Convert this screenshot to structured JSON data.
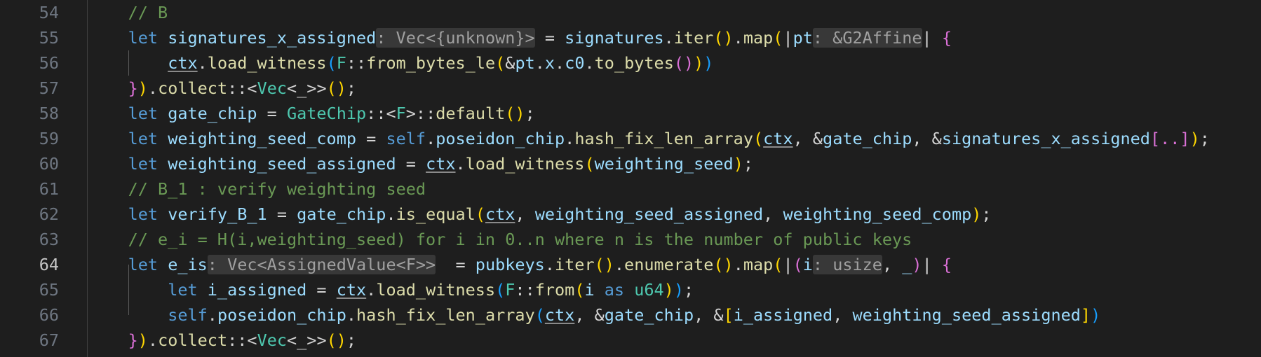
{
  "editor": {
    "active_line": "64",
    "colors": {
      "background": "#1e1e1e",
      "keyword": "#569cd6",
      "variable": "#9cdcfe",
      "function": "#dcdcaa",
      "type": "#4ec9b0",
      "comment": "#6a9955",
      "bracket_gold": "#ffd700",
      "bracket_purple": "#da70d6",
      "bracket_blue": "#179fff"
    },
    "lines": [
      {
        "number": "54",
        "indent": "    ",
        "tokens": [
          {
            "t": "// B",
            "c": "cm"
          }
        ]
      },
      {
        "number": "55",
        "indent": "    ",
        "tokens": [
          {
            "t": "let ",
            "c": "kw"
          },
          {
            "t": "signatures_x_assigned",
            "c": "var"
          },
          {
            "t": ": Vec<{unknown}>",
            "c": "hint"
          },
          {
            "t": " = ",
            "c": "p"
          },
          {
            "t": "signatures",
            "c": "var"
          },
          {
            "t": ".",
            "c": "p"
          },
          {
            "t": "iter",
            "c": "fn"
          },
          {
            "t": "()",
            "c": "b1"
          },
          {
            "t": ".",
            "c": "p"
          },
          {
            "t": "map",
            "c": "fn"
          },
          {
            "t": "(",
            "c": "b1"
          },
          {
            "t": "|",
            "c": "p"
          },
          {
            "t": "pt",
            "c": "var"
          },
          {
            "t": ": &G2Affine",
            "c": "hint"
          },
          {
            "t": "| ",
            "c": "p"
          },
          {
            "t": "{",
            "c": "b2"
          }
        ]
      },
      {
        "number": "56",
        "indent": "        ",
        "tokens": [
          {
            "t": "ctx",
            "c": "var-u"
          },
          {
            "t": ".",
            "c": "p"
          },
          {
            "t": "load_witness",
            "c": "fn"
          },
          {
            "t": "(",
            "c": "b3"
          },
          {
            "t": "F",
            "c": "type"
          },
          {
            "t": "::",
            "c": "p"
          },
          {
            "t": "from_bytes_le",
            "c": "fn"
          },
          {
            "t": "(",
            "c": "b1"
          },
          {
            "t": "&",
            "c": "p"
          },
          {
            "t": "pt",
            "c": "var"
          },
          {
            "t": ".",
            "c": "p"
          },
          {
            "t": "x",
            "c": "var"
          },
          {
            "t": ".",
            "c": "p"
          },
          {
            "t": "c0",
            "c": "var"
          },
          {
            "t": ".",
            "c": "p"
          },
          {
            "t": "to_bytes",
            "c": "fn"
          },
          {
            "t": "()",
            "c": "b2"
          },
          {
            "t": ")",
            "c": "b1"
          },
          {
            "t": ")",
            "c": "b3"
          }
        ]
      },
      {
        "number": "57",
        "indent": "    ",
        "tokens": [
          {
            "t": "}",
            "c": "b2"
          },
          {
            "t": ")",
            "c": "b1"
          },
          {
            "t": ".",
            "c": "p"
          },
          {
            "t": "collect",
            "c": "fn"
          },
          {
            "t": "::<",
            "c": "p"
          },
          {
            "t": "Vec",
            "c": "type"
          },
          {
            "t": "<_>>",
            "c": "p"
          },
          {
            "t": "()",
            "c": "b1"
          },
          {
            "t": ";",
            "c": "p"
          }
        ]
      },
      {
        "number": "58",
        "indent": "    ",
        "tokens": [
          {
            "t": "let ",
            "c": "kw"
          },
          {
            "t": "gate_chip",
            "c": "var"
          },
          {
            "t": " = ",
            "c": "p"
          },
          {
            "t": "GateChip",
            "c": "type"
          },
          {
            "t": "::<",
            "c": "p"
          },
          {
            "t": "F",
            "c": "type"
          },
          {
            "t": ">::",
            "c": "p"
          },
          {
            "t": "default",
            "c": "fn"
          },
          {
            "t": "()",
            "c": "b1"
          },
          {
            "t": ";",
            "c": "p"
          }
        ]
      },
      {
        "number": "59",
        "indent": "    ",
        "tokens": [
          {
            "t": "let ",
            "c": "kw"
          },
          {
            "t": "weighting_seed_comp",
            "c": "var"
          },
          {
            "t": " = ",
            "c": "p"
          },
          {
            "t": "self",
            "c": "kw"
          },
          {
            "t": ".",
            "c": "p"
          },
          {
            "t": "poseidon_chip",
            "c": "var"
          },
          {
            "t": ".",
            "c": "p"
          },
          {
            "t": "hash_fix_len_array",
            "c": "fn"
          },
          {
            "t": "(",
            "c": "b1"
          },
          {
            "t": "ctx",
            "c": "u"
          },
          {
            "t": ", &",
            "c": "p"
          },
          {
            "t": "gate_chip",
            "c": "var"
          },
          {
            "t": ", &",
            "c": "p"
          },
          {
            "t": "signatures_x_assigned",
            "c": "var"
          },
          {
            "t": "[..]",
            "c": "b2"
          },
          {
            "t": ")",
            "c": "b1"
          },
          {
            "t": ";",
            "c": "p"
          }
        ]
      },
      {
        "number": "60",
        "indent": "    ",
        "tokens": [
          {
            "t": "let ",
            "c": "kw"
          },
          {
            "t": "weighting_seed_assigned",
            "c": "var"
          },
          {
            "t": " = ",
            "c": "p"
          },
          {
            "t": "ctx",
            "c": "u"
          },
          {
            "t": ".",
            "c": "p"
          },
          {
            "t": "load_witness",
            "c": "fn"
          },
          {
            "t": "(",
            "c": "b1"
          },
          {
            "t": "weighting_seed",
            "c": "var"
          },
          {
            "t": ")",
            "c": "b1"
          },
          {
            "t": ";",
            "c": "p"
          }
        ]
      },
      {
        "number": "61",
        "indent": "    ",
        "tokens": [
          {
            "t": "// B_1 : verify weighting seed",
            "c": "cm"
          }
        ]
      },
      {
        "number": "62",
        "indent": "    ",
        "tokens": [
          {
            "t": "let ",
            "c": "kw"
          },
          {
            "t": "verify_B_1",
            "c": "var"
          },
          {
            "t": " = ",
            "c": "p"
          },
          {
            "t": "gate_chip",
            "c": "var"
          },
          {
            "t": ".",
            "c": "p"
          },
          {
            "t": "is_equal",
            "c": "fn"
          },
          {
            "t": "(",
            "c": "b1"
          },
          {
            "t": "ctx",
            "c": "u"
          },
          {
            "t": ", ",
            "c": "p"
          },
          {
            "t": "weighting_seed_assigned",
            "c": "var"
          },
          {
            "t": ", ",
            "c": "p"
          },
          {
            "t": "weighting_seed_comp",
            "c": "var"
          },
          {
            "t": ")",
            "c": "b1"
          },
          {
            "t": ";",
            "c": "p"
          }
        ]
      },
      {
        "number": "63",
        "indent": "    ",
        "tokens": [
          {
            "t": "// e_i = H(i,weighting_seed) for i in 0..n where n is the number of public keys",
            "c": "cm"
          }
        ]
      },
      {
        "number": "64",
        "indent": "    ",
        "tokens": [
          {
            "t": "let ",
            "c": "kw"
          },
          {
            "t": "e_is",
            "c": "var"
          },
          {
            "t": ": Vec<AssignedValue<F>>",
            "c": "hint"
          },
          {
            "t": "  = ",
            "c": "p"
          },
          {
            "t": "pubkeys",
            "c": "var"
          },
          {
            "t": ".",
            "c": "p"
          },
          {
            "t": "iter",
            "c": "fn"
          },
          {
            "t": "()",
            "c": "b1"
          },
          {
            "t": ".",
            "c": "p"
          },
          {
            "t": "enumerate",
            "c": "fn"
          },
          {
            "t": "()",
            "c": "b1"
          },
          {
            "t": ".",
            "c": "p"
          },
          {
            "t": "map",
            "c": "fn"
          },
          {
            "t": "(",
            "c": "b1"
          },
          {
            "t": "|",
            "c": "p"
          },
          {
            "t": "(",
            "c": "b2"
          },
          {
            "t": "i",
            "c": "var"
          },
          {
            "t": ": usize",
            "c": "hint"
          },
          {
            "t": ", ",
            "c": "p"
          },
          {
            "t": "_",
            "c": "var"
          },
          {
            "t": ")",
            "c": "b2"
          },
          {
            "t": "| ",
            "c": "p"
          },
          {
            "t": "{",
            "c": "b2"
          }
        ]
      },
      {
        "number": "65",
        "indent": "        ",
        "tokens": [
          {
            "t": "let ",
            "c": "kw"
          },
          {
            "t": "i_assigned",
            "c": "var"
          },
          {
            "t": " = ",
            "c": "p"
          },
          {
            "t": "ctx",
            "c": "u"
          },
          {
            "t": ".",
            "c": "p"
          },
          {
            "t": "load_witness",
            "c": "fn"
          },
          {
            "t": "(",
            "c": "b3"
          },
          {
            "t": "F",
            "c": "type"
          },
          {
            "t": "::",
            "c": "p"
          },
          {
            "t": "from",
            "c": "fn"
          },
          {
            "t": "(",
            "c": "b1"
          },
          {
            "t": "i",
            "c": "var"
          },
          {
            "t": " as ",
            "c": "kw"
          },
          {
            "t": "u64",
            "c": "type"
          },
          {
            "t": ")",
            "c": "b1"
          },
          {
            "t": ")",
            "c": "b3"
          },
          {
            "t": ";",
            "c": "p"
          }
        ]
      },
      {
        "number": "66",
        "indent": "        ",
        "tokens": [
          {
            "t": "self",
            "c": "kw"
          },
          {
            "t": ".",
            "c": "p"
          },
          {
            "t": "poseidon_chip",
            "c": "var"
          },
          {
            "t": ".",
            "c": "p"
          },
          {
            "t": "hash_fix_len_array",
            "c": "fn"
          },
          {
            "t": "(",
            "c": "b3"
          },
          {
            "t": "ctx",
            "c": "u"
          },
          {
            "t": ", &",
            "c": "p"
          },
          {
            "t": "gate_chip",
            "c": "var"
          },
          {
            "t": ", &",
            "c": "p"
          },
          {
            "t": "[",
            "c": "b1"
          },
          {
            "t": "i_assigned",
            "c": "var"
          },
          {
            "t": ", ",
            "c": "p"
          },
          {
            "t": "weighting_seed_assigned",
            "c": "var"
          },
          {
            "t": "]",
            "c": "b1"
          },
          {
            "t": ")",
            "c": "b3"
          }
        ]
      },
      {
        "number": "67",
        "indent": "    ",
        "tokens": [
          {
            "t": "}",
            "c": "b2"
          },
          {
            "t": ")",
            "c": "b1"
          },
          {
            "t": ".",
            "c": "p"
          },
          {
            "t": "collect",
            "c": "fn"
          },
          {
            "t": "::<",
            "c": "p"
          },
          {
            "t": "Vec",
            "c": "type"
          },
          {
            "t": "<_>>",
            "c": "p"
          },
          {
            "t": "()",
            "c": "b1"
          },
          {
            "t": ";",
            "c": "p"
          }
        ]
      }
    ]
  }
}
